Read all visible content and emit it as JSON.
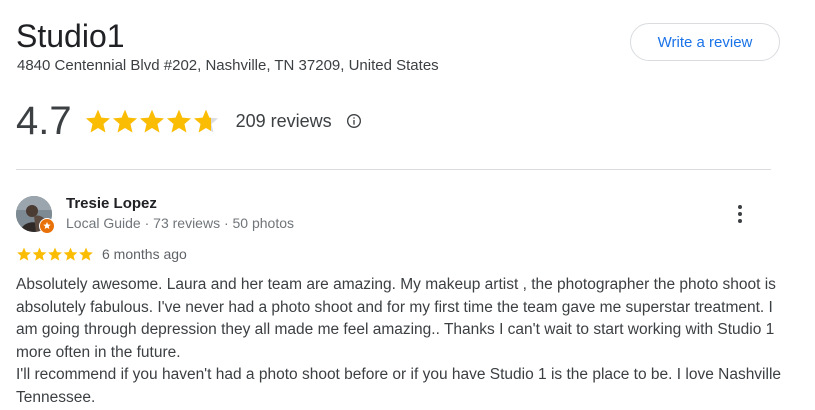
{
  "business": {
    "name": "Studio1",
    "address": "4840 Centennial Blvd #202, Nashville, TN 37209, United States"
  },
  "actions": {
    "write_review_label": "Write a review"
  },
  "rating": {
    "value": "4.7",
    "stars_filled": 4.7,
    "review_count": "209 reviews",
    "star_color": "#fbbc04",
    "star_empty_color": "#dadce0"
  },
  "icons": {
    "info": "info-circle-icon",
    "more": "more-vert-icon",
    "star": "star-icon",
    "local_guide_badge": "local-guide-badge-icon"
  },
  "review": {
    "reviewer_name": "Tresie Lopez",
    "reviewer_meta": "Local Guide · 73 reviews · 50 photos",
    "stars": 5,
    "date": "6 months ago",
    "text_paragraph_1": "Absolutely awesome. Laura and her team are amazing. My makeup artist , the photographer the photo shoot is absolutely fabulous. I've never had a photo shoot and for my first time the team gave me superstar treatment. I am going through depression they all made me feel amazing.. Thanks I can't wait to start working with Studio 1 more often in the future.",
    "text_paragraph_2": "I'll recommend if you haven't had a photo shoot before or if you have Studio 1 is the place to be. I love Nashville Tennessee."
  },
  "colors": {
    "accent": "#1a73e8",
    "badge": "#e8710a"
  }
}
